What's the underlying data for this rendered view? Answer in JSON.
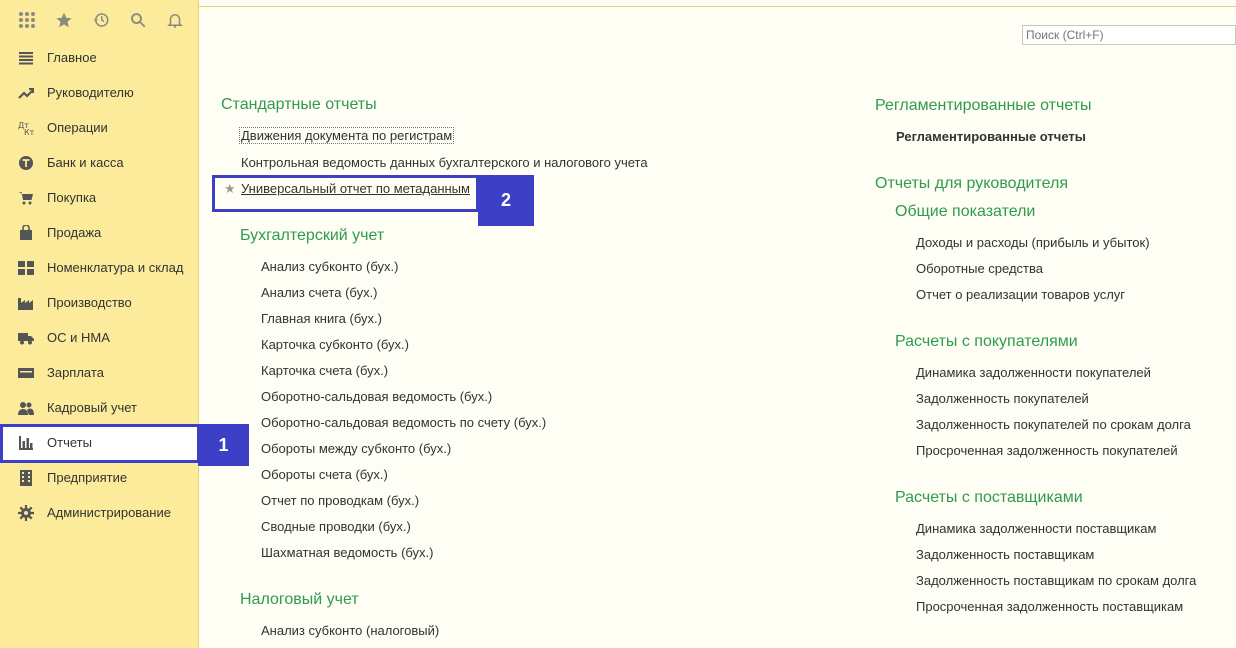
{
  "search": {
    "placeholder": "Поиск (Ctrl+F)"
  },
  "topbar": [
    "apps-grid-icon",
    "star-icon",
    "history-icon",
    "search-icon",
    "bell-icon"
  ],
  "sidebar": {
    "items": [
      {
        "label": "Главное",
        "icon": "menu-icon"
      },
      {
        "label": "Руководителю",
        "icon": "trend-icon"
      },
      {
        "label": "Операции",
        "icon": "operations-icon"
      },
      {
        "label": "Банк и касса",
        "icon": "bank-icon"
      },
      {
        "label": "Покупка",
        "icon": "cart-icon"
      },
      {
        "label": "Продажа",
        "icon": "bag-icon"
      },
      {
        "label": "Номенклатура и склад",
        "icon": "warehouse-icon"
      },
      {
        "label": "Производство",
        "icon": "factory-icon"
      },
      {
        "label": "ОС и НМА",
        "icon": "truck-icon"
      },
      {
        "label": "Зарплата",
        "icon": "salary-icon"
      },
      {
        "label": "Кадровый учет",
        "icon": "people-icon"
      },
      {
        "label": "Отчеты",
        "icon": "chart-icon"
      },
      {
        "label": "Предприятие",
        "icon": "building-icon"
      },
      {
        "label": "Администрирование",
        "icon": "gear-icon"
      }
    ]
  },
  "badges": {
    "first": "1",
    "second": "2"
  },
  "left": {
    "standard_title": "Стандартные отчеты",
    "standard_items": [
      "Движения документа по регистрам",
      "Контрольная ведомость данных бухгалтерского и налогового учета",
      "Универсальный отчет по метаданным"
    ],
    "accounting_title": "Бухгалтерский учет",
    "accounting_items": [
      "Анализ субконто (бух.)",
      "Анализ счета (бух.)",
      "Главная книга (бух.)",
      "Карточка субконто (бух.)",
      "Карточка счета (бух.)",
      "Оборотно-сальдовая ведомость (бух.)",
      "Оборотно-сальдовая ведомость по счету (бух.)",
      "Обороты между субконто (бух.)",
      "Обороты счета (бух.)",
      "Отчет по проводкам (бух.)",
      "Сводные проводки (бух.)",
      "Шахматная ведомость (бух.)"
    ],
    "tax_title": "Налоговый учет",
    "tax_items": [
      "Анализ субконто (налоговый)"
    ]
  },
  "right": {
    "reg_title": "Регламентированные отчеты",
    "reg_item": "Регламентированные отчеты",
    "manager_title": "Отчеты для руководителя",
    "general_title": "Общие показатели",
    "general_items": [
      "Доходы и расходы (прибыль и убыток)",
      "Оборотные средства",
      "Отчет о реализации товаров услуг"
    ],
    "buyers_title": "Расчеты с покупателями",
    "buyers_items": [
      "Динамика задолженности покупателей",
      "Задолженность покупателей",
      "Задолженность покупателей по срокам долга",
      "Просроченная задолженность покупателей"
    ],
    "suppliers_title": "Расчеты с поставщиками",
    "suppliers_items": [
      "Динамика задолженности поставщикам",
      "Задолженность поставщикам",
      "Задолженность поставщикам по срокам долга",
      "Просроченная задолженность поставщикам"
    ]
  }
}
